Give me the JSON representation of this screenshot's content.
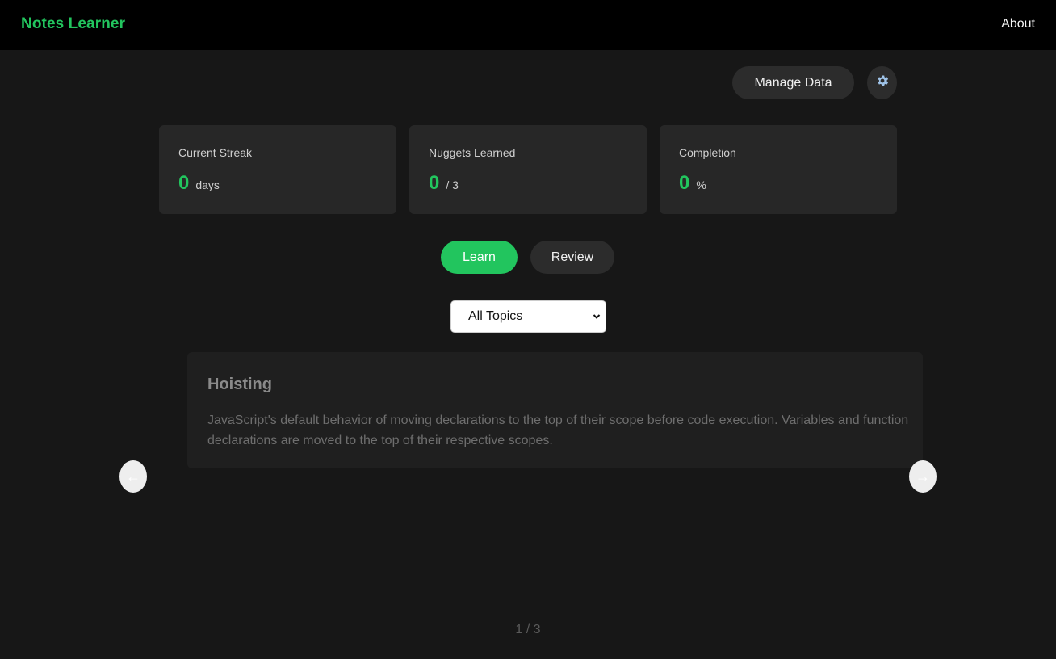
{
  "header": {
    "brand": "Notes Learner",
    "about_label": "About"
  },
  "toolbar": {
    "manage_data_label": "Manage Data",
    "settings_icon": "gear-icon"
  },
  "stats": [
    {
      "label": "Current Streak",
      "value": "0",
      "unit": "days"
    },
    {
      "label": "Nuggets Learned",
      "value": "0",
      "unit": "/ 3"
    },
    {
      "label": "Completion",
      "value": "0",
      "unit": "%"
    }
  ],
  "tabs": {
    "learn_label": "Learn",
    "review_label": "Review",
    "active": "Learn"
  },
  "topic_filter": {
    "selected": "All Topics"
  },
  "nugget": {
    "title": "Hoisting",
    "body": "JavaScript's default behavior of moving declarations to the top of their scope before code execution. Variables and function declarations are moved to the top of their respective scopes."
  },
  "navigation": {
    "prev_icon": "arrow-left-icon",
    "next_icon": "arrow-right-icon",
    "pager": "1 / 3"
  },
  "colors": {
    "accent": "#22c55e",
    "background": "#171717",
    "header_background": "#000000",
    "card_background": "#272727"
  }
}
